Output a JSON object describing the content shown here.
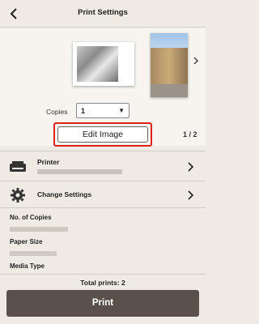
{
  "header": {
    "title": "Print Settings",
    "back_icon": "arrow-left-icon"
  },
  "preview": {
    "copies_label": "Copies",
    "copies_value": "1",
    "edit_button": "Edit Image",
    "page_indicator": "1 / 2"
  },
  "settings": {
    "printer_label": "Printer",
    "change_settings_label": "Change Settings",
    "no_of_copies_label": "No. of Copies",
    "paper_size_label": "Paper Size",
    "media_type_label": "Media Type"
  },
  "footer": {
    "total_prints": "Total prints: 2",
    "print_button": "Print"
  },
  "colors": {
    "background": "#efebe4",
    "print_button": "#5a524a",
    "highlight": "#e0221d"
  }
}
